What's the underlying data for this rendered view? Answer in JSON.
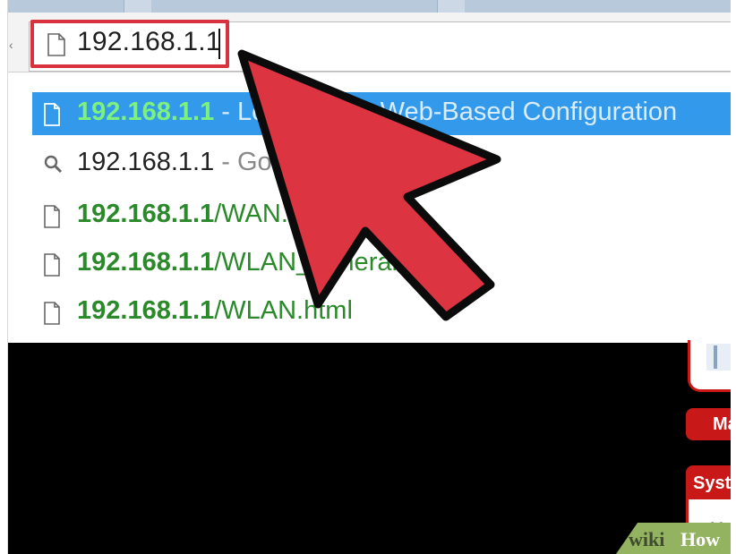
{
  "omnibox": {
    "value": "192.168.1.1",
    "icon": "page-icon"
  },
  "suggestions": [
    {
      "icon": "page-icon",
      "host": "192.168.1.1",
      "separator": " - ",
      "rest": "Login to the Web-Based Configuration",
      "selected": true
    },
    {
      "icon": "search-icon",
      "query": "192.168.1.1",
      "rest": " - Google Search",
      "selected": false
    },
    {
      "icon": "page-icon",
      "host": "192.168.1.1",
      "path": "/WAN.html",
      "selected": false
    },
    {
      "icon": "page-icon",
      "host": "192.168.1.1",
      "path": "/WLAN_general.html",
      "selected": false
    },
    {
      "icon": "page-icon",
      "host": "192.168.1.1",
      "path": "/WLAN.html",
      "selected": false
    }
  ],
  "router_page": {
    "menu_main_label": "Ma",
    "menu_system_label": "Syst",
    "system_body_text": "Mo"
  },
  "watermark": {
    "part1": "wiki",
    "part2": "How"
  },
  "colors": {
    "highlight_red": "#d8323f",
    "selection_blue": "#3399ea",
    "url_green": "#2a8a2a",
    "arrow_red": "#dc3440",
    "router_red": "#c81818",
    "wikihow_green": "#93b360"
  }
}
